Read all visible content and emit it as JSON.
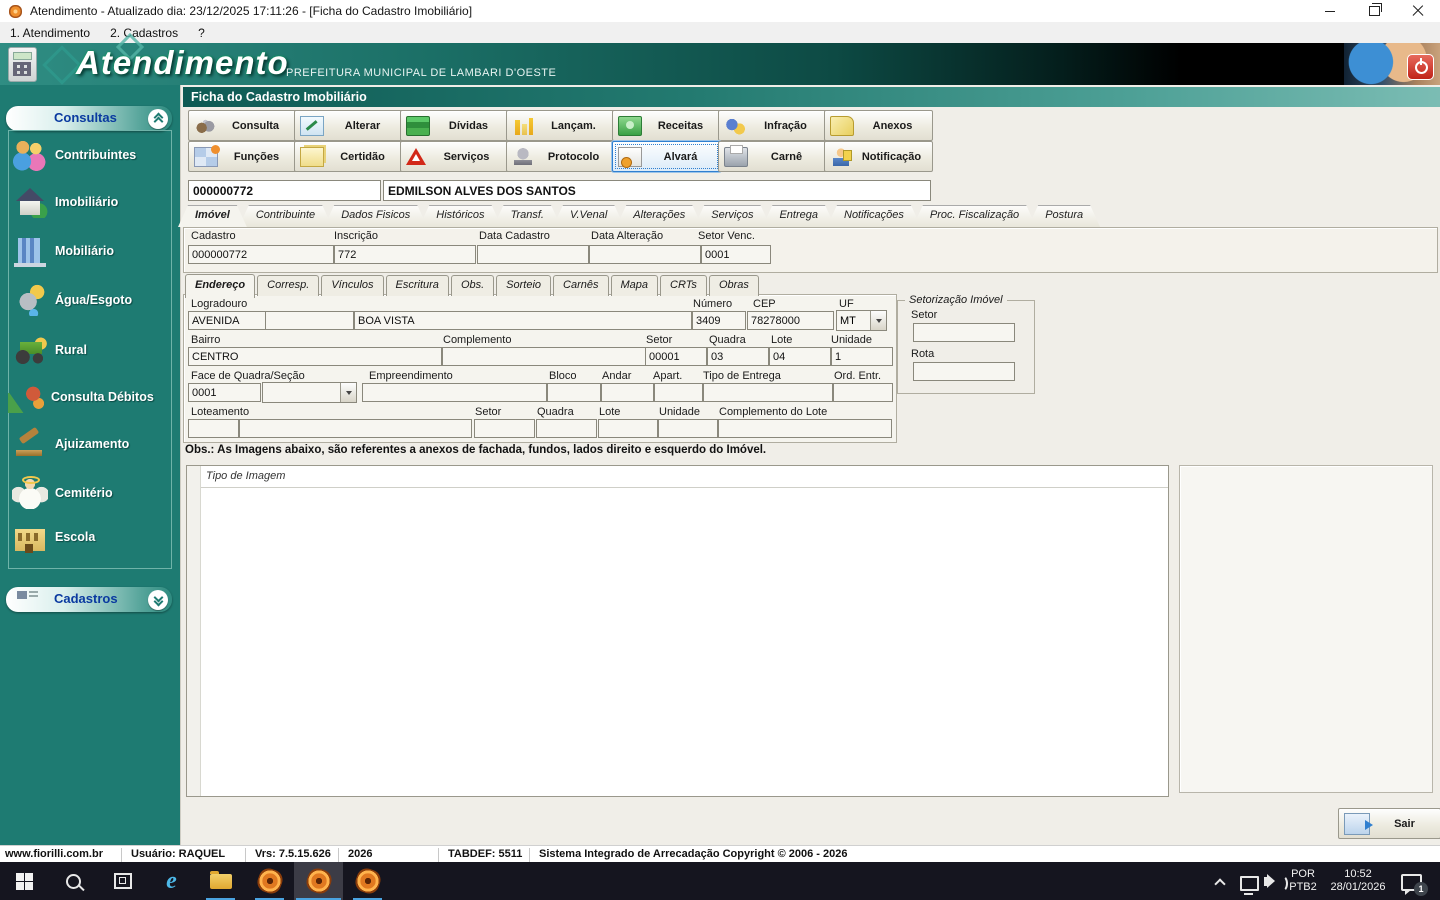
{
  "window": {
    "title": "Atendimento - Atualizado dia: 23/12/2025 17:11:26 - [Ficha do Cadastro Imobiliário]",
    "menu": [
      "1. Atendimento",
      "2. Cadastros",
      "?"
    ]
  },
  "banner": {
    "app_name": "Atendimento",
    "subtitle": "PREFEITURA MUNICIPAL DE LAMBARI D'OESTE"
  },
  "sidebar": {
    "consultas_label": "Consultas",
    "cadastros_label": "Cadastros",
    "items": [
      {
        "label": "Contribuintes",
        "icon": "people-icon"
      },
      {
        "label": "Imobiliário",
        "icon": "house-icon"
      },
      {
        "label": "Mobiliário",
        "icon": "building-icon"
      },
      {
        "label": "Água/Esgoto",
        "icon": "faucet-icon"
      },
      {
        "label": "Rural",
        "icon": "tractor-icon"
      },
      {
        "label": "Consulta Débitos",
        "icon": "debts-search-icon"
      },
      {
        "label": "Ajuizamento",
        "icon": "gavel-icon"
      },
      {
        "label": "Cemitério",
        "icon": "angel-icon"
      },
      {
        "label": "Escola",
        "icon": "school-icon"
      }
    ]
  },
  "page": {
    "caption": "Ficha do Cadastro Imobiliário"
  },
  "toolbar": {
    "row1": [
      {
        "label": "Consulta",
        "icon": "binoculars-icon"
      },
      {
        "label": "Alterar",
        "icon": "edit-icon"
      },
      {
        "label": "Dívidas",
        "icon": "books-icon"
      },
      {
        "label": "Lançam.",
        "icon": "chart-bars-icon"
      },
      {
        "label": "Receitas",
        "icon": "money-icon"
      },
      {
        "label": "Infração",
        "icon": "infraction-icon"
      },
      {
        "label": "Anexos",
        "icon": "attachment-note-icon"
      }
    ],
    "row2": [
      {
        "label": "Funções",
        "icon": "functions-grid-icon"
      },
      {
        "label": "Certidão",
        "icon": "certificate-pages-icon"
      },
      {
        "label": "Serviços",
        "icon": "warning-triangle-icon"
      },
      {
        "label": "Protocolo",
        "icon": "stamp-icon"
      },
      {
        "label": "Alvará",
        "icon": "license-seal-icon"
      },
      {
        "label": "Carnê",
        "icon": "printer-icon"
      },
      {
        "label": "Notificação",
        "icon": "person-notify-icon"
      }
    ]
  },
  "record": {
    "code": "000000772",
    "name": "EDMILSON ALVES DOS SANTOS"
  },
  "tabs": [
    "Imóvel",
    "Contribuinte",
    "Dados Fisicos",
    "Históricos",
    "Transf.",
    "V.Venal",
    "Alterações",
    "Serviços",
    "Entrega",
    "Notificações",
    "Proc. Fiscalização",
    "Postura"
  ],
  "cadastro": {
    "labels": [
      "Cadastro",
      "Inscrição",
      "Data Cadastro",
      "Data Alteração",
      "Setor Venc."
    ],
    "values": {
      "cadastro": "000000772",
      "inscricao": "772",
      "data_cadastro": "",
      "data_alteracao": "",
      "setor_venc": "0001"
    }
  },
  "subtabs": [
    "Endereço",
    "Corresp.",
    "Vínculos",
    "Escritura",
    "Obs.",
    "Sorteio",
    "Carnês",
    "Mapa",
    "CRTs",
    "Obras"
  ],
  "endereco": {
    "logradouro_label": "Logradouro",
    "numero_label": "Número",
    "cep_label": "CEP",
    "uf_label": "UF",
    "bairro_label": "Bairro",
    "complemento_label": "Complemento",
    "setor_label": "Setor",
    "quadra_label": "Quadra",
    "lote_label": "Lote",
    "unidade_label": "Unidade",
    "face_label": "Face de Quadra/Seção",
    "empreendimento_label": "Empreendimento",
    "bloco_label": "Bloco",
    "andar_label": "Andar",
    "apart_label": "Apart.",
    "tipo_entrega_label": "Tipo de Entrega",
    "ord_entr_label": "Ord. Entr.",
    "loteamento_label": "Loteamento",
    "lot_setor_label": "Setor",
    "lot_quadra_label": "Quadra",
    "lot_lote_label": "Lote",
    "lot_unidade_label": "Unidade",
    "compl_lote_label": "Complemento do Lote",
    "values": {
      "tipo_logradouro": "AVENIDA",
      "cod_logradouro": "",
      "logradouro": "BOA VISTA",
      "numero": "3409",
      "cep": "78278000",
      "uf": "MT",
      "bairro": "CENTRO",
      "complemento": "",
      "setor": "00001",
      "quadra": "03",
      "lote": "04",
      "unidade": "1",
      "face": "0001"
    }
  },
  "setorizacao": {
    "title": "Setorização Imóvel",
    "setor_label": "Setor",
    "rota_label": "Rota"
  },
  "obs_text": "Obs.: As Imagens abaixo, são referentes a anexos de fachada, fundos, lados direito e esquerdo do Imóvel.",
  "image_grid": {
    "header": "Tipo de Imagem"
  },
  "footer": {
    "sair_label": "Sair"
  },
  "statusbar": {
    "items": [
      "www.fiorilli.com.br",
      "Usuário: RAQUEL",
      "Vrs: 7.5.15.626",
      "2026",
      "TABDEF: 5511",
      "Sistema Integrado de Arrecadação Copyright © 2006 - 2026"
    ]
  },
  "taskbar": {
    "tray": {
      "lang_top": "POR",
      "lang_bottom": "PTB2",
      "time": "10:52",
      "date": "28/01/2026",
      "badge": "1"
    },
    "icons": [
      "start-icon",
      "search-icon",
      "task-view-icon",
      "ie-icon",
      "file-explorer-icon",
      "fiorilli-app-icon",
      "fiorilli-app-icon",
      "fiorilli-app-icon"
    ]
  },
  "colors": {
    "sidebar_teal": "#1E7B72",
    "caption_teal_dark": "#0E5A54",
    "caption_teal_light": "#7CBDB4",
    "focus_blue": "#2F7FD0",
    "taskbar_bg": "#15151F",
    "taskbar_underline": "#4AA3E0",
    "group_label_blue": "#0A3AA0",
    "power_red": "#C02318"
  }
}
